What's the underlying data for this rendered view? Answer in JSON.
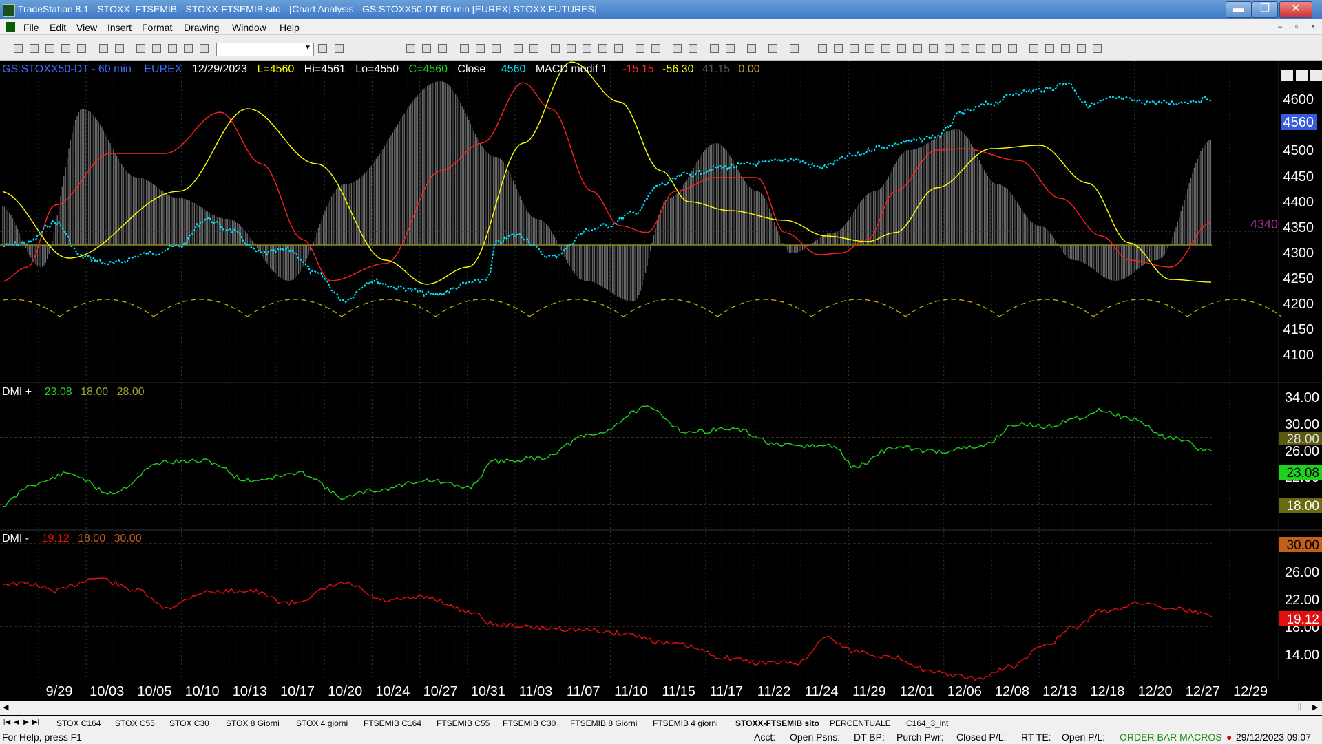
{
  "window": {
    "title": "TradeStation 8.1 - STOXX_FTSEMIB - STOXX-FTSEMIB sito - [Chart Analysis - GS:STOXX50-DT  60 min  [EUREX] STOXX FUTURES]",
    "min_label": "▬",
    "max_label": "❐",
    "close_label": "✕"
  },
  "menu": [
    "File",
    "Edit",
    "View",
    "Insert",
    "Format",
    "Drawing",
    "Window",
    "Help"
  ],
  "chart": {
    "symbol": "GS:STOXX50-DT - 60 min",
    "exchange": "EUREX",
    "date": "12/29/2023",
    "last": "L=4560",
    "high": "Hi=4561",
    "low": "Lo=4550",
    "close": "C=4560",
    "close_label": "Close",
    "close_value": "4560",
    "indicator_name": "MACD modif 1",
    "ind_v1": "-15.15",
    "ind_v2": "-56.30",
    "ind_v3": "41.15",
    "ind_v4": "0.00",
    "price_marker": "4340",
    "last_price_badge": "4560",
    "price_ticks": [
      "4600",
      "4550",
      "4500",
      "4450",
      "4400",
      "4350",
      "4300",
      "4250",
      "4200",
      "4150",
      "4100"
    ],
    "dmi_plus": {
      "label": "DMI +",
      "v1": "23.08",
      "v2": "18.00",
      "v3": "28.00",
      "ticks": [
        "34.00",
        "30.00",
        "26.00",
        "22.00"
      ],
      "badge_28": "28.00",
      "badge_current": "23.08",
      "badge_18": "18.00"
    },
    "dmi_minus": {
      "label": "DMI -",
      "v1": "19.12",
      "v2": "18.00",
      "v3": "30.00",
      "ticks": [
        "26.00",
        "22.00",
        "18.00",
        "14.00"
      ],
      "badge_30": "30.00",
      "badge_current": "19.12"
    },
    "dates": [
      "9/29",
      "10/03",
      "10/05",
      "10/10",
      "10/13",
      "10/17",
      "10/20",
      "10/24",
      "10/27",
      "10/31",
      "11/03",
      "11/07",
      "11/10",
      "11/15",
      "11/17",
      "11/22",
      "11/24",
      "11/29",
      "12/01",
      "12/06",
      "12/08",
      "12/13",
      "12/18",
      "12/20",
      "12/27",
      "12/29"
    ],
    "colors": {
      "price": "#00e5ff",
      "macd": "#ff2020",
      "signal": "#ffff00",
      "dmi_plus": "#20d020",
      "dmi_minus": "#e01010",
      "hist": "#808080"
    }
  },
  "tabs": [
    "STOX C164",
    "STOX C55",
    "STOX C30",
    "STOX 8 Giorni",
    "STOX 4 giorni",
    "FTSEMIB C164",
    "FTSEMIB C55",
    "FTSEMIB C30",
    "FTSEMIB 8 Giorni",
    "FTSEMIB 4 giorni",
    "STOXX-FTSEMIB sito",
    "PERCENTUALE",
    "C164_3_lnt"
  ],
  "active_tab": "STOXX-FTSEMIB sito",
  "status": {
    "help": "For Help, press F1",
    "acct": "Acct:",
    "open_psns": "Open Psns:",
    "dt_bp": "DT BP:",
    "purch_pwr": "Purch Pwr:",
    "closed_pl": "Closed P/L:",
    "rt_te": "RT TE:",
    "open_pl": "Open P/L:",
    "macros": "ORDER BAR  MACROS",
    "datetime": "29/12/2023 09:07"
  }
}
